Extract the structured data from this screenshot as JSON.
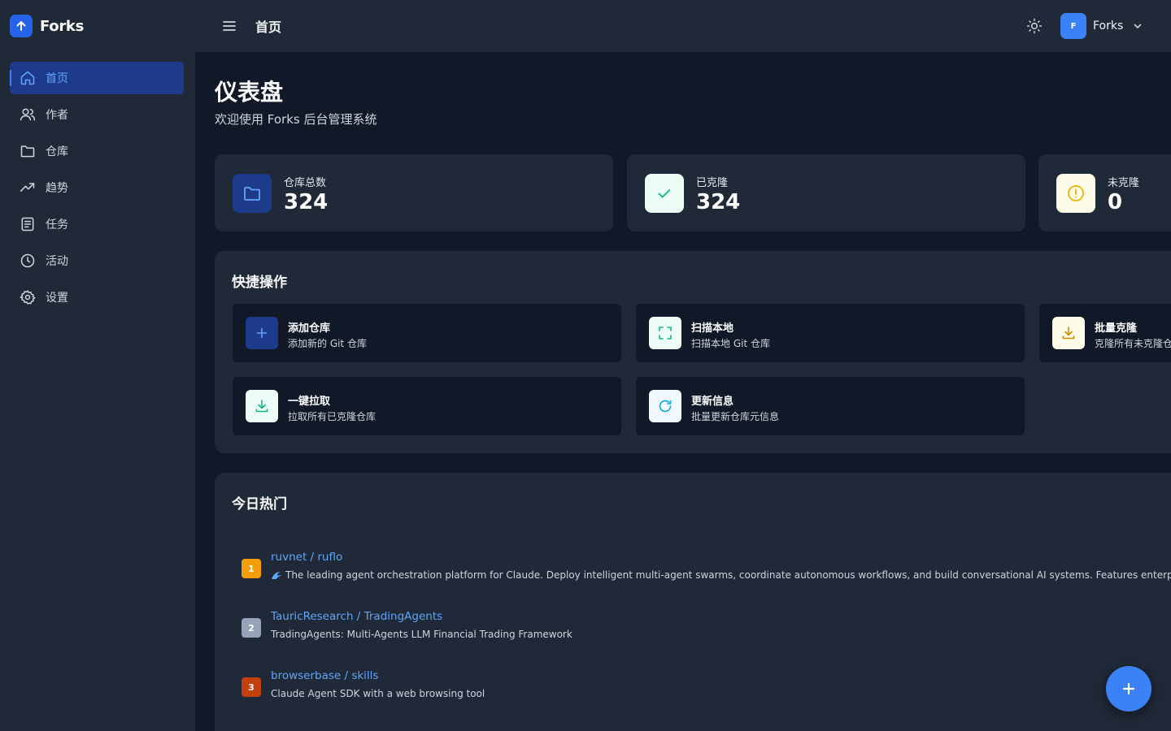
{
  "app": {
    "brand": "Forks"
  },
  "topbar": {
    "title": "首页",
    "user_name": "Forks",
    "avatar_text": "F"
  },
  "sidebar": {
    "items": [
      {
        "label": "首页",
        "icon": "home-icon",
        "active": true
      },
      {
        "label": "作者",
        "icon": "users-icon"
      },
      {
        "label": "仓库",
        "icon": "folder-icon"
      },
      {
        "label": "趋势",
        "icon": "trending-up-icon"
      },
      {
        "label": "任务",
        "icon": "task-list-icon"
      },
      {
        "label": "活动",
        "icon": "clock-icon"
      },
      {
        "label": "设置",
        "icon": "gear-icon"
      }
    ]
  },
  "page": {
    "title": "仪表盘",
    "subtitle": "欢迎使用 Forks 后台管理系统"
  },
  "stats": [
    {
      "label": "仓库总数",
      "value": "324",
      "icon": "folder-icon",
      "color": "#60a5fa"
    },
    {
      "label": "已克隆",
      "value": "324",
      "icon": "check-icon",
      "color": "#10b981"
    },
    {
      "label": "未克隆",
      "value": "0",
      "icon": "alert-circle-icon",
      "color": "#eab308"
    }
  ],
  "quick_actions": {
    "title": "快捷操作",
    "items": [
      {
        "title": "添加仓库",
        "desc": "添加新的 Git 仓库",
        "icon": "plus-icon"
      },
      {
        "title": "扫描本地",
        "desc": "扫描本地 Git 仓库",
        "icon": "scan-icon"
      },
      {
        "title": "批量克隆",
        "desc": "克隆所有未克隆仓库",
        "icon": "download-icon"
      },
      {
        "title": "一键拉取",
        "desc": "拉取所有已克隆仓库",
        "icon": "download-icon"
      },
      {
        "title": "更新信息",
        "desc": "批量更新仓库元信息",
        "icon": "refresh-icon"
      }
    ]
  },
  "trending": {
    "title": "今日热门",
    "items": [
      {
        "rank": "1",
        "name": "ruvnet / ruflo",
        "desc": "The leading agent orchestration platform for Claude. Deploy intelligent multi-agent swarms, coordinate autonomous workflows, and build conversational AI systems. Features enterprise-grade architecture, s",
        "color": "#f59e0b"
      },
      {
        "rank": "2",
        "name": "TauricResearch / TradingAgents",
        "desc": "TradingAgents: Multi-Agents LLM Financial Trading Framework",
        "color": "#94a3b8"
      },
      {
        "rank": "3",
        "name": "browserbase / skills",
        "desc": "Claude Agent SDK with a web browsing tool",
        "color": "#c2410c"
      }
    ]
  }
}
